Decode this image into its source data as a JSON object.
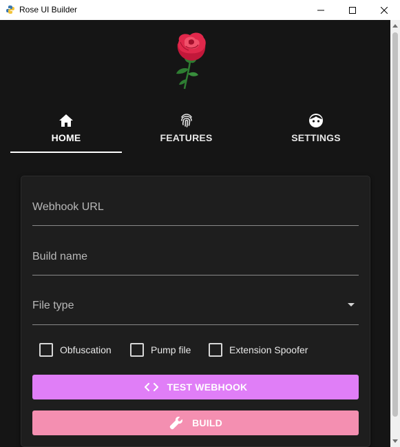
{
  "window": {
    "title": "Rose UI Builder"
  },
  "tabs": [
    {
      "label": "HOME",
      "icon": "home-icon",
      "active": true
    },
    {
      "label": "FEATURES",
      "icon": "fingerprint-icon",
      "active": false
    },
    {
      "label": "SETTINGS",
      "icon": "face-icon",
      "active": false
    }
  ],
  "form": {
    "webhook_placeholder": "Webhook URL",
    "webhook_value": "",
    "build_name_placeholder": "Build name",
    "build_name_value": "",
    "file_type_label": "File type",
    "checkboxes": [
      {
        "label": "Obfuscation",
        "checked": false
      },
      {
        "label": "Pump file",
        "checked": false
      },
      {
        "label": "Extension Spoofer",
        "checked": false
      }
    ],
    "test_webhook_label": "TEST WEBHOOK",
    "build_label": "BUILD"
  },
  "colors": {
    "background": "#151515",
    "card": "#1e1e1e",
    "test_button": "#e07ef7",
    "build_button": "#f48fb1",
    "rose_petal": "#d81b3c",
    "stem": "#2e7d32"
  }
}
